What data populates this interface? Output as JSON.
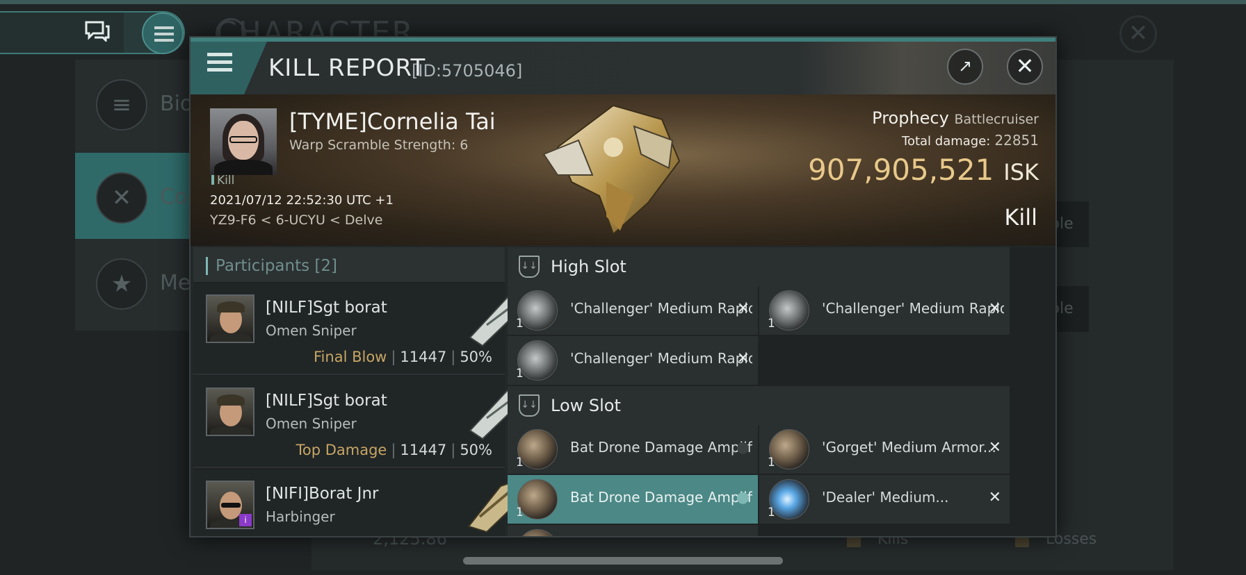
{
  "background": {
    "title": "CHARACTER",
    "left_menu": [
      {
        "label": "Bio",
        "icon": "menu-icon"
      },
      {
        "label": "Co",
        "icon": "crossed-swords-icon"
      },
      {
        "label": "Me",
        "icon": "star-badge-icon"
      }
    ],
    "side_buttons": [
      "ble",
      "ble"
    ],
    "bottom": {
      "value": "2,125.86",
      "kills_label": "Kills",
      "losses_label": "Losses"
    }
  },
  "header": {
    "title": "KILL REPORT",
    "id": "[ID:5705046]"
  },
  "victim": {
    "name": "[TYME]Cornelia Tai",
    "detail": "Warp Scramble Strength: 6",
    "tag": "Kill",
    "timestamp": "2021/07/12 22:52:30 UTC +1",
    "location": "YZ9-F6 < 6-UCYU < Delve",
    "ship": "Prophecy",
    "ship_class": "Battlecruiser",
    "total_damage_label": "Total damage:",
    "total_damage": "22851",
    "isk_value": "907,905,521",
    "isk_unit": "ISK",
    "result": "Kill"
  },
  "participants": {
    "title": "Participants",
    "count": "[2]",
    "rows": [
      {
        "name": "[NILF]Sgt borat",
        "ship": "Omen Sniper",
        "label": "Final Blow",
        "damage": "11447",
        "percent": "50%"
      },
      {
        "name": "[NILF]Sgt borat",
        "ship": "Omen Sniper",
        "label": "Top Damage",
        "damage": "11447",
        "percent": "50%"
      },
      {
        "name": "[NIFI]Borat Jnr",
        "ship": "Harbinger"
      }
    ]
  },
  "fitting": {
    "high_slot": {
      "title": "High Slot",
      "modules": [
        {
          "name": "'Challenger' Medium Rapid...",
          "qty": "1"
        },
        {
          "name": "'Challenger' Medium Rapid...",
          "qty": "1"
        },
        {
          "name": "'Challenger' Medium Rapid...",
          "qty": "1"
        }
      ]
    },
    "low_slot": {
      "title": "Low Slot",
      "modules": [
        {
          "name": "Bat Drone Damage Amplifier",
          "qty": "1"
        },
        {
          "name": "'Gorget' Medium Armor...",
          "qty": "1"
        },
        {
          "name": "Bat Drone Damage Amplifier",
          "qty": "1"
        },
        {
          "name": "'Dealer' Medium...",
          "qty": "1"
        }
      ]
    }
  },
  "colors": {
    "accent": "#4b8886",
    "isk": "#e8c98a",
    "label_gold": "#c7a664"
  }
}
